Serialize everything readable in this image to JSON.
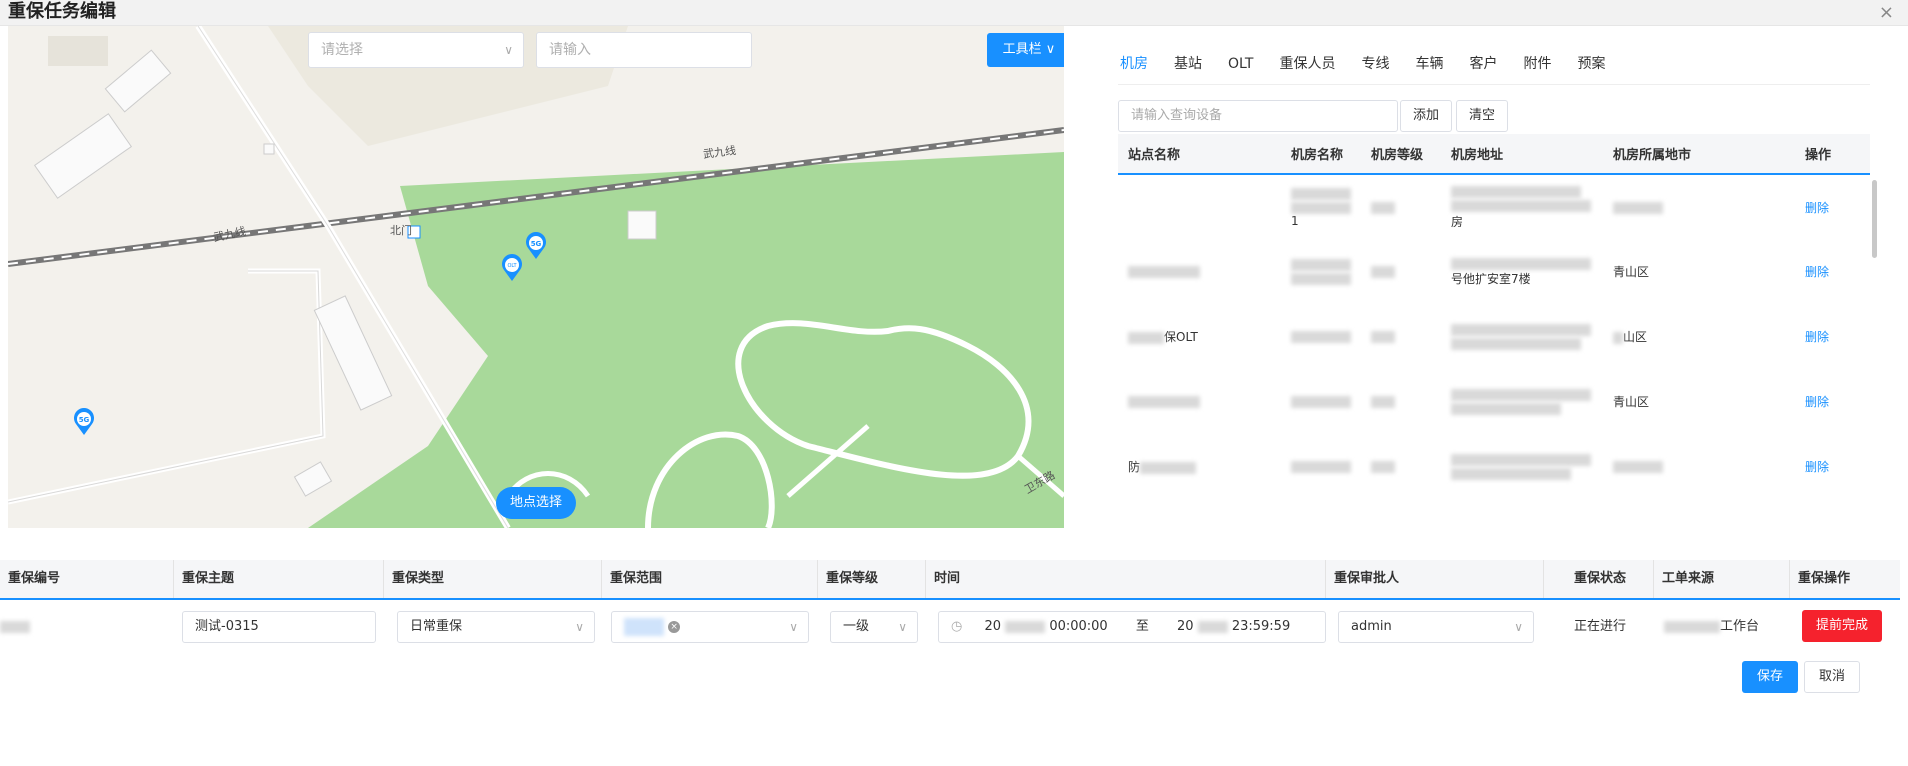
{
  "dialog": {
    "title": "重保任务编辑",
    "close_label": "×"
  },
  "map": {
    "select_placeholder": "请选择",
    "input_placeholder": "请输入",
    "toolbar_label": "工具栏 ∨",
    "location_button": "地点选择",
    "road_label_1": "武九线",
    "road_label_2": "武九线",
    "north_gate": "北门",
    "road_label_3": "卫东路",
    "pin_5g": "5G",
    "pin_olt": "OLT"
  },
  "tabs": [
    "机房",
    "基站",
    "OLT",
    "重保人员",
    "专线",
    "车辆",
    "客户",
    "附件",
    "预案"
  ],
  "device_panel": {
    "search_placeholder": "请输入查询设备",
    "add_label": "添加",
    "clear_label": "清空",
    "columns": [
      "站点名称",
      "机房名称",
      "机房等级",
      "机房地址",
      "机房所属地市",
      "操作"
    ],
    "rows": [
      {
        "site": "",
        "room_extra": "1",
        "address_extra": "房",
        "city": "",
        "action": "删除"
      },
      {
        "site": "",
        "room_extra": "",
        "address_extra": "号他扩安室7楼",
        "city": "青山区",
        "action": "删除"
      },
      {
        "site": "保OLT",
        "room_extra": "",
        "address_extra": "",
        "city": "山区",
        "action": "删除"
      },
      {
        "site": "",
        "room_extra": "",
        "address_extra": "",
        "city": "青山区",
        "action": "删除"
      },
      {
        "site": "防",
        "room_extra": "",
        "address_extra": "",
        "city": "",
        "action": "删除"
      }
    ]
  },
  "form": {
    "headers": [
      "重保编号",
      "重保主题",
      "重保类型",
      "重保范围",
      "重保等级",
      "时间",
      "重保审批人",
      "重保状态",
      "工单来源",
      "重保操作"
    ],
    "topic": "测试-0315",
    "type": "日常重保",
    "level": "一级",
    "time_start_prefix": "20",
    "time_start_suffix": "00:00:00",
    "time_sep": "至",
    "time_end_prefix": "20",
    "time_end_suffix": "23:59:59",
    "approver": "admin",
    "status": "正在进行",
    "source_suffix": "工作台",
    "early_finish": "提前完成",
    "save": "保存",
    "cancel": "取消"
  }
}
